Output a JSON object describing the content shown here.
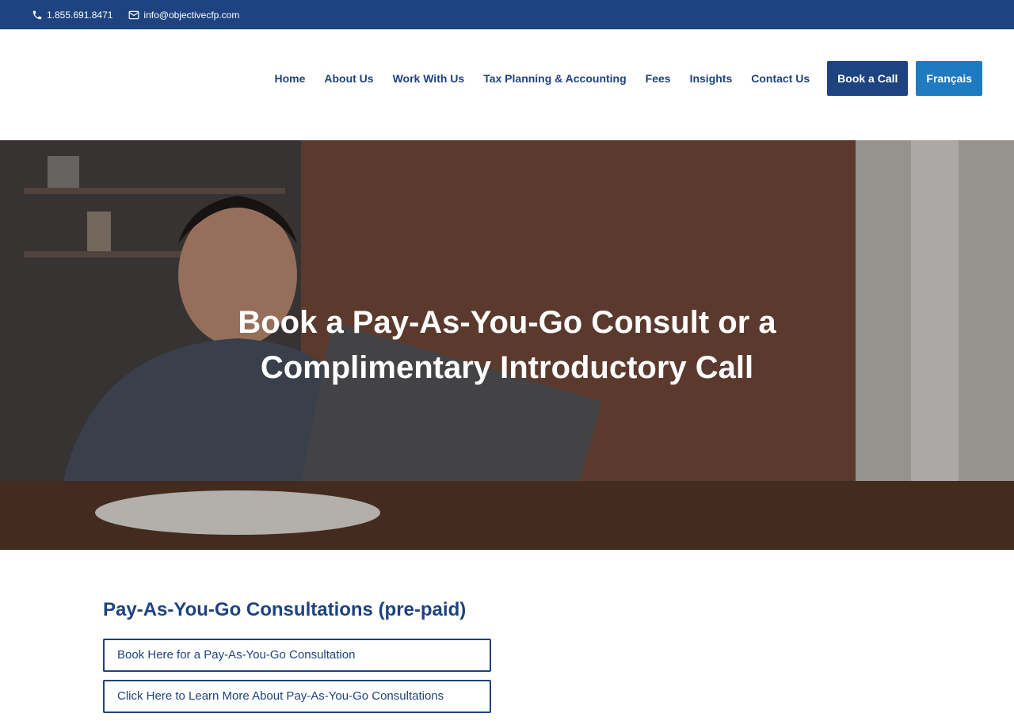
{
  "topbar": {
    "phone": "1.855.691.8471",
    "email": "info@objectivecfp.com"
  },
  "nav": {
    "items": [
      "Home",
      "About Us",
      "Work With Us",
      "Tax Planning & Accounting",
      "Fees",
      "Insights",
      "Contact Us"
    ],
    "book_call": "Book a Call",
    "language": "Français"
  },
  "hero": {
    "title_line1": "Book a Pay-As-You-Go Consult or a",
    "title_line2": "Complimentary Introductory Call"
  },
  "content": {
    "section_title": "Pay-As-You-Go Consultations (pre-paid)",
    "buttons": [
      "Book Here for a Pay-As-You-Go Consultation",
      "Click Here to Learn More About Pay-As-You-Go Consultations"
    ]
  },
  "colors": {
    "brand_navy": "#1d4380",
    "accent_blue": "#1f7bc1",
    "white": "#ffffff"
  }
}
